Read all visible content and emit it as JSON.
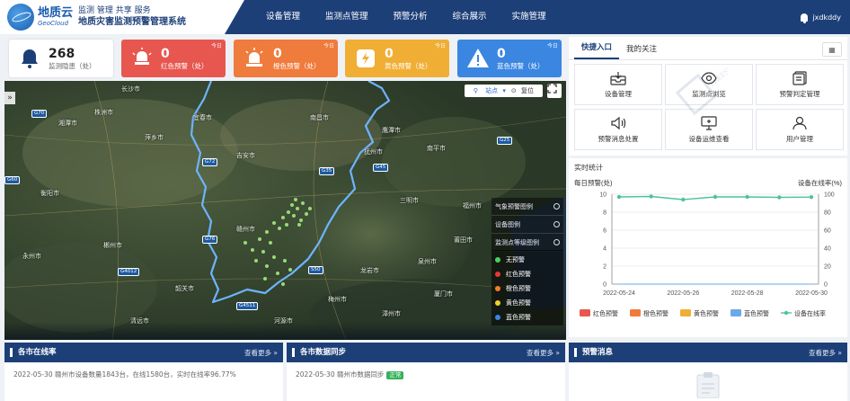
{
  "brand": {
    "logo_cn": "地质云",
    "logo_en": "GeoCloud",
    "subtitle": "监测 管理 共享 服务",
    "title": "地质灾害监测预警管理系统"
  },
  "nav": [
    "设备管理",
    "监测点管理",
    "预警分析",
    "综合展示",
    "实施管理"
  ],
  "user": {
    "name": "jxdkddy"
  },
  "stats": {
    "total": {
      "value": "268",
      "label": "监测隐患（处）"
    },
    "red": {
      "value": "0",
      "label": "红色预警（处）",
      "tag": "今日"
    },
    "orange": {
      "value": "0",
      "label": "橙色预警（处）",
      "tag": "今日"
    },
    "yellow": {
      "value": "0",
      "label": "黄色预警（处）",
      "tag": "今日"
    },
    "blue": {
      "value": "0",
      "label": "蓝色预警（处）",
      "tag": "今日"
    }
  },
  "map": {
    "tools": {
      "selected": "站点",
      "reset": "复位"
    },
    "layers": [
      "气象预警图例",
      "设备图例",
      "监测点等级图例"
    ],
    "legend": [
      {
        "label": "无预警",
        "color": "#4cd05a"
      },
      {
        "label": "红色预警",
        "color": "#e53935"
      },
      {
        "label": "橙色预警",
        "color": "#f57c2a"
      },
      {
        "label": "黄色预警",
        "color": "#f2cf2e"
      },
      {
        "label": "蓝色预警",
        "color": "#3b86e0"
      }
    ],
    "places": [
      "长沙市",
      "南昌市",
      "宜春市",
      "抚州市",
      "吉安市",
      "赣州市",
      "萍乡市",
      "株洲市",
      "湘潭市",
      "衡阳市",
      "郴州市",
      "永州市",
      "韶关市",
      "梅州市",
      "龙岩市",
      "三明市",
      "福州市",
      "泉州市",
      "厦门市",
      "漳州市",
      "河源市",
      "清远市",
      "莆田市",
      "南平市",
      "鹰潭市"
    ],
    "roads": [
      "G70",
      "G72",
      "G60",
      "G35",
      "G76",
      "G45",
      "G4511",
      "G4012",
      "G25",
      "S50"
    ]
  },
  "quick": {
    "tabs": [
      "快捷入口",
      "我的关注"
    ],
    "items": [
      "设备管理",
      "监测点浏览",
      "预警判定管理",
      "预警消息处置",
      "设备运维查看",
      "用户管理"
    ]
  },
  "realtime": {
    "title": "实时统计"
  },
  "chart_data": {
    "type": "line",
    "ylabel_left": "每日预警(处)",
    "ylabel_right": "设备在线率(%)",
    "ylim_left": [
      0,
      10
    ],
    "ylim_right": [
      0,
      100
    ],
    "yticks_left": [
      0,
      2,
      4,
      6,
      8,
      10
    ],
    "yticks_right": [
      0,
      20,
      40,
      60,
      80,
      100
    ],
    "x": [
      "2022-05-24",
      "2022-05-25",
      "2022-05-26",
      "2022-05-27",
      "2022-05-28",
      "2022-05-29",
      "2022-05-30"
    ],
    "xticks": [
      "2022-05-24",
      "2022-05-26",
      "2022-05-28",
      "2022-05-30"
    ],
    "series": [
      {
        "name": "红色预警",
        "color": "#e7574f",
        "values": [
          0,
          0,
          0,
          0,
          0,
          0,
          0
        ]
      },
      {
        "name": "橙色预警",
        "color": "#ef7b3c",
        "values": [
          0,
          0,
          0,
          0,
          0,
          0,
          0
        ]
      },
      {
        "name": "黄色预警",
        "color": "#f0ae35",
        "values": [
          0,
          0,
          0,
          0,
          0,
          0,
          0
        ]
      },
      {
        "name": "蓝色预警",
        "color": "#6aa8e8",
        "values": [
          0,
          0,
          0,
          0,
          0,
          0,
          0
        ]
      },
      {
        "name": "设备在线率",
        "color": "#4cc3a0",
        "values": [
          97,
          97.5,
          94,
          97,
          97,
          96.5,
          96.8
        ]
      }
    ]
  },
  "panels": {
    "online": {
      "title": "各市在线率",
      "more": "查看更多",
      "text": "2022-05-30  赣州市设备数量1843台，在线1580台，实时在线率96.77%"
    },
    "sync": {
      "title": "各市数据同步",
      "more": "查看更多",
      "text": "2022-05-30  赣州市数据同步",
      "badge": "正常"
    },
    "alert": {
      "title": "预警消息",
      "more": "查看更多"
    }
  },
  "watermark": "FREESUN 飞尚科技"
}
